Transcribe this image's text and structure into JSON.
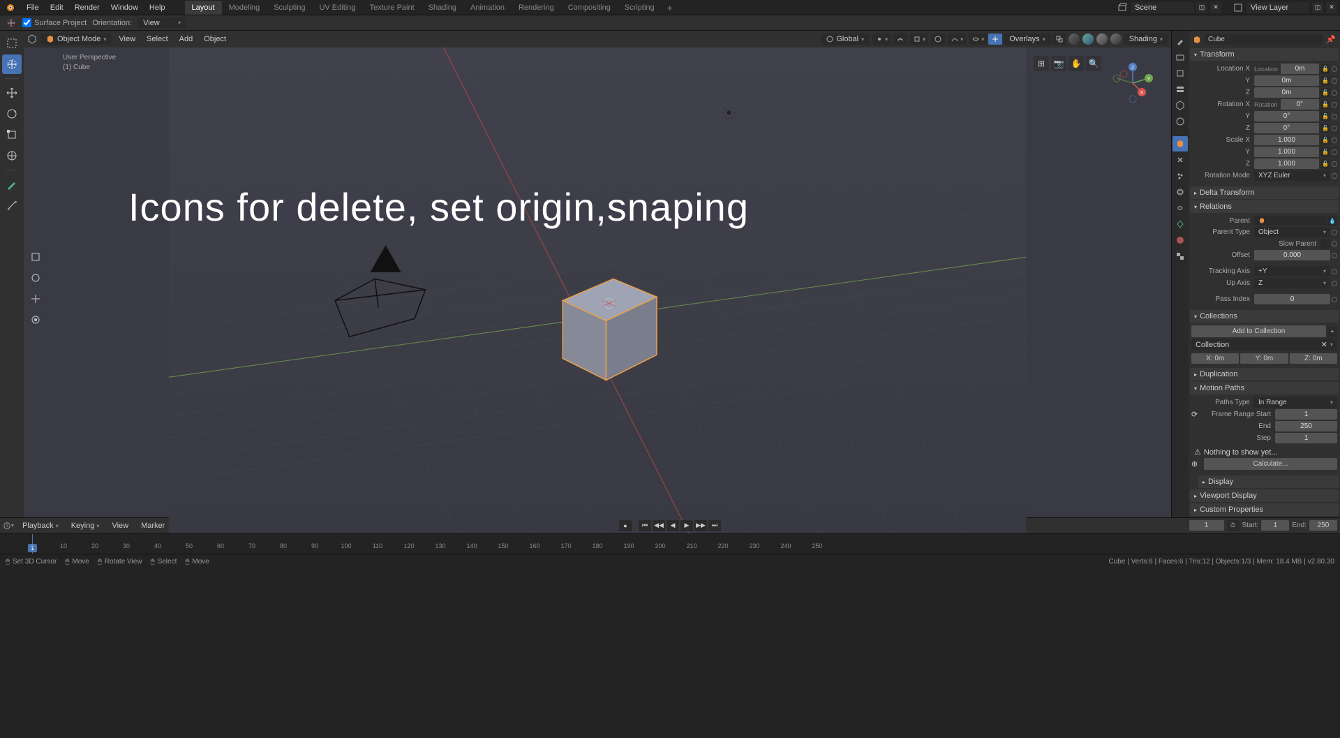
{
  "menus": [
    "File",
    "Edit",
    "Render",
    "Window",
    "Help"
  ],
  "workspaces": [
    "Layout",
    "Modeling",
    "Sculpting",
    "UV Editing",
    "Texture Paint",
    "Shading",
    "Animation",
    "Rendering",
    "Compositing",
    "Scripting"
  ],
  "active_workspace": "Layout",
  "scene": "Scene",
  "view_layer": "View Layer",
  "toolbar2": {
    "surface_project": "Surface Project",
    "orientation": "Orientation:",
    "orientation_value": "View"
  },
  "viewport": {
    "mode": "Object Mode",
    "menus": [
      "View",
      "Select",
      "Add",
      "Object"
    ],
    "orientation": "Global",
    "overlays": "Overlays",
    "shading": "Shading",
    "perspective": "User Perspective",
    "object_count": "(1) Cube",
    "big_text": "Icons for delete, set origin,snaping"
  },
  "header_object": "Cube",
  "transform": {
    "title": "Transform",
    "loc_label": "Location X",
    "loc_hint": "Location",
    "loc_x": "0m",
    "loc_y": "0m",
    "loc_z": "0m",
    "y": "Y",
    "z": "Z",
    "rot_label": "Rotation X",
    "rot_hint": "Rotation",
    "rot_x": "0°",
    "rot_y": "0°",
    "rot_z": "0°",
    "scale_label": "Scale X",
    "scale_x": "1.000",
    "scale_y": "1.000",
    "scale_z": "1.000",
    "mode_label": "Rotation Mode",
    "mode_value": "XYZ Euler"
  },
  "delta_transform": "Delta Transform",
  "relations": {
    "title": "Relations",
    "parent": "Parent",
    "parent_type": "Parent Type",
    "parent_type_value": "Object",
    "slow_parent": "Slow Parent",
    "offset": "Offset",
    "offset_value": "0.000",
    "tracking_axis": "Tracking Axis",
    "tracking_value": "+Y",
    "up_axis": "Up Axis",
    "up_value": "Z",
    "pass_index": "Pass Index",
    "pass_value": "0"
  },
  "collections": {
    "title": "Collections",
    "add": "Add to Collection",
    "name": "Collection",
    "x_label": "X:",
    "x": "0m",
    "y_label": "Y:",
    "y": "0m",
    "z_label": "Z:",
    "z": "0m"
  },
  "duplication": "Duplication",
  "motion_paths": {
    "title": "Motion Paths",
    "paths_type_label": "Paths Type",
    "paths_type": "In Range",
    "frame_start_label": "Frame Range Start",
    "frame_start": "1",
    "end_label": "End",
    "end": "250",
    "step_label": "Step",
    "step": "1",
    "warning": "Nothing to show yet...",
    "calculate": "Calculate..."
  },
  "display": "Display",
  "viewport_display": "Viewport Display",
  "custom_props": "Custom Properties",
  "timeline": {
    "playback": "Playback",
    "keying": "Keying",
    "view": "View",
    "marker": "Marker",
    "current": "1",
    "start_label": "Start:",
    "start": "1",
    "end_label": "End:",
    "end": "250",
    "ticks": [
      "1",
      "10",
      "20",
      "30",
      "40",
      "50",
      "60",
      "70",
      "80",
      "90",
      "100",
      "110",
      "120",
      "130",
      "140",
      "150",
      "160",
      "170",
      "180",
      "190",
      "200",
      "210",
      "220",
      "230",
      "240",
      "250"
    ]
  },
  "status": {
    "cursor": "Set 3D Cursor",
    "move": "Move",
    "rotate": "Rotate View",
    "select": "Select",
    "move2": "Move",
    "info": "Cube | Verts:8 | Faces:6 | Tris:12 | Objects:1/3 | Mem: 18.4 MB | v2.80.30"
  }
}
